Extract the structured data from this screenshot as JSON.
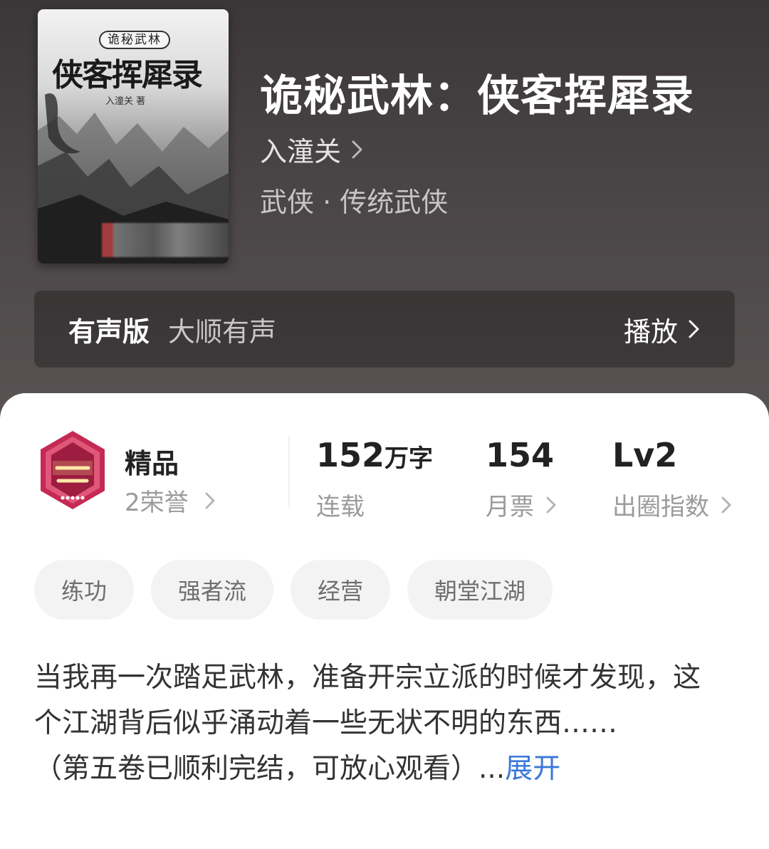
{
  "book": {
    "cover": {
      "series_text": "诡秘武林",
      "title_text": "侠客挥犀录",
      "author_text": "入潼关 著"
    },
    "title": "诡秘武林：侠客挥犀录",
    "author": "入潼关",
    "genre": "武侠 · 传统武侠"
  },
  "audio": {
    "label": "有声版",
    "narrator": "大顺有声",
    "play_label": "播放"
  },
  "stats": {
    "quality_label": "精品",
    "honors": "2荣誉",
    "word_count_value": "152",
    "word_count_unit": "万字",
    "status": "连载",
    "monthly_votes_value": "154",
    "monthly_votes_label": "月票",
    "level_value": "Lv2",
    "level_label": "出圈指数"
  },
  "tags": [
    "练功",
    "强者流",
    "经营",
    "朝堂江湖"
  ],
  "description": {
    "main": "当我再一次踏足武林，准备开宗立派的时候才发现，这个江湖背后似乎涌动着一些无状不明的东西……",
    "note": "（第五卷已顺利完结，可放心观看）...",
    "expand_label": "展开"
  },
  "colors": {
    "hero_bg": "#4a4546",
    "accent_link": "#3b78d8"
  },
  "icons": {
    "chevron": "chevron-right-icon",
    "badge": "premium-channel-badge-icon"
  }
}
